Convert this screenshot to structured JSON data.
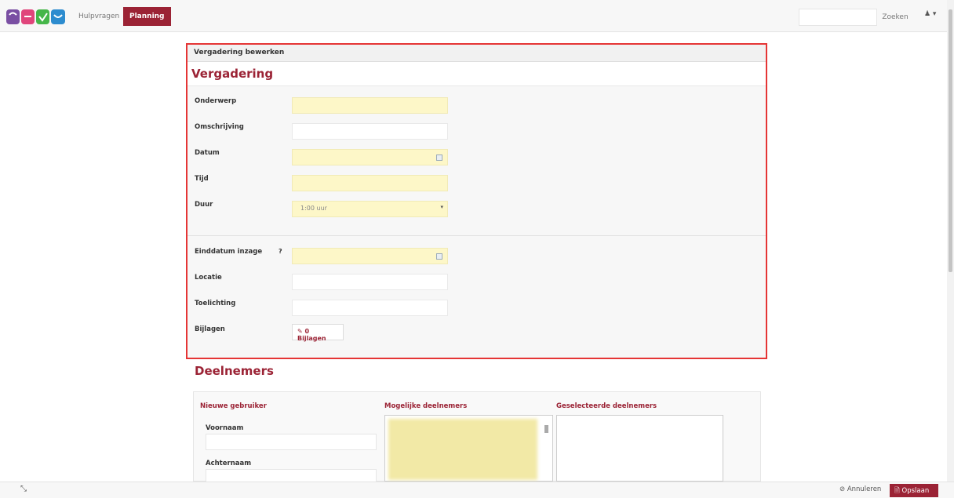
{
  "nav": {
    "hulpvragen": "Hulpvragen",
    "planning": "Planning"
  },
  "search": {
    "button": "Zoeken",
    "placeholder": ""
  },
  "user_menu": "♟ ▾",
  "panel": {
    "heading": "Vergadering bewerken",
    "title": "Vergadering",
    "fields": {
      "onderwerp": {
        "label": "Onderwerp",
        "value": ""
      },
      "omschrijving": {
        "label": "Omschrijving",
        "value": ""
      },
      "datum": {
        "label": "Datum",
        "value": ""
      },
      "tijd": {
        "label": "Tijd",
        "value": ""
      },
      "duur": {
        "label": "Duur",
        "value": "1:00 uur"
      },
      "einddatum": {
        "label": "Einddatum inzage",
        "help": "?",
        "value": ""
      },
      "locatie": {
        "label": "Locatie",
        "value": ""
      },
      "toelichting": {
        "label": "Toelichting",
        "value": ""
      },
      "bijlagen": {
        "label": "Bijlagen",
        "button": "✎ 0 Bijlagen"
      }
    }
  },
  "deelnemers": {
    "title": "Deelnemers",
    "nieuwe_gebruiker": "Nieuwe gebruiker",
    "mogelijke": "Mogelijke deelnemers",
    "geselecteerde": "Geselecteerde deelnemers",
    "voornaam": "Voornaam",
    "achternaam": "Achternaam"
  },
  "footer": {
    "annuleren": "⊘ Annuleren",
    "opslaan": "🗎 Opslaan",
    "expand": "⤡"
  },
  "colors": {
    "brand": "#9b2335",
    "highlight": "#e53535",
    "required_bg": "#fdf7c8"
  }
}
